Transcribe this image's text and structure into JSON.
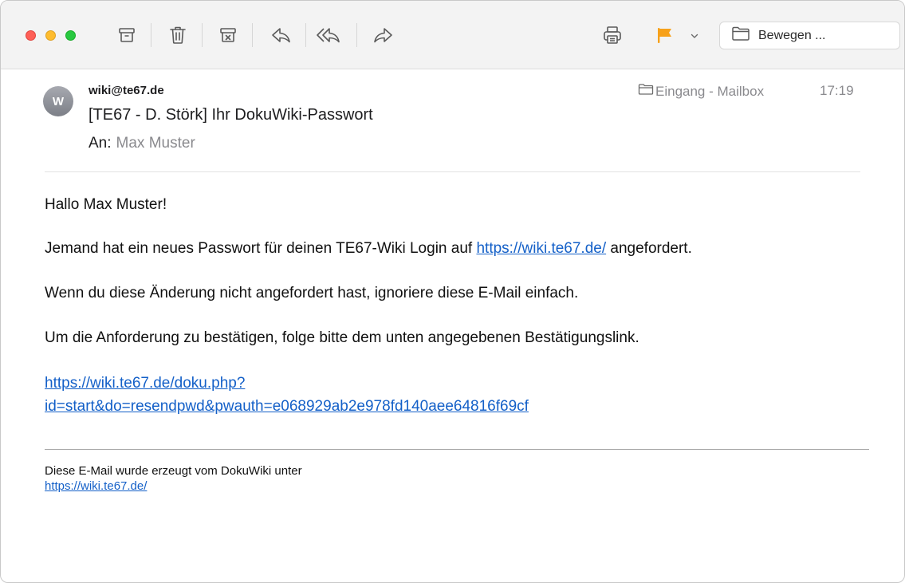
{
  "toolbar": {
    "icons": [
      "archive-icon",
      "trash-icon",
      "junk-icon",
      "reply-icon",
      "reply-all-icon",
      "forward-icon",
      "print-icon",
      "flag-icon",
      "chevron-down-icon",
      "folder-icon"
    ],
    "flag_color": "#f7a11a",
    "move_label": "Bewegen ..."
  },
  "message": {
    "avatar_initial": "W",
    "from": "wiki@te67.de",
    "subject": "[TE67 - D. Störk] Ihr DokuWiki-Passwort",
    "to_label": "An:",
    "to_value": "Max Muster",
    "mailbox": "Eingang - Mailbox",
    "time": "17:19"
  },
  "body": {
    "greeting": "Hallo Max Muster!",
    "para1_before": "Jemand hat ein neues Passwort für deinen TE67-Wiki Login auf ",
    "para1_link": "https://wiki.te67.de/",
    "para1_after": " angefordert.",
    "para2": "Wenn du diese Änderung nicht angefordert hast, ignoriere diese E-Mail einfach.",
    "para3": "Um die Anforderung zu bestätigen, folge bitte dem unten angegebenen Bestätigungslink.",
    "confirm_link_line1": "https://wiki.te67.de/doku.php?",
    "confirm_link_line2": "id=start&do=resendpwd&pwauth=e068929ab2e978fd140aee64816f69cf",
    "footer_text": "Diese E-Mail wurde erzeugt vom DokuWiki unter",
    "footer_link": "https://wiki.te67.de/"
  },
  "colors": {
    "link": "#1460c8",
    "close": "#fe5f57",
    "minimize": "#febc2e",
    "zoom": "#28c840"
  }
}
